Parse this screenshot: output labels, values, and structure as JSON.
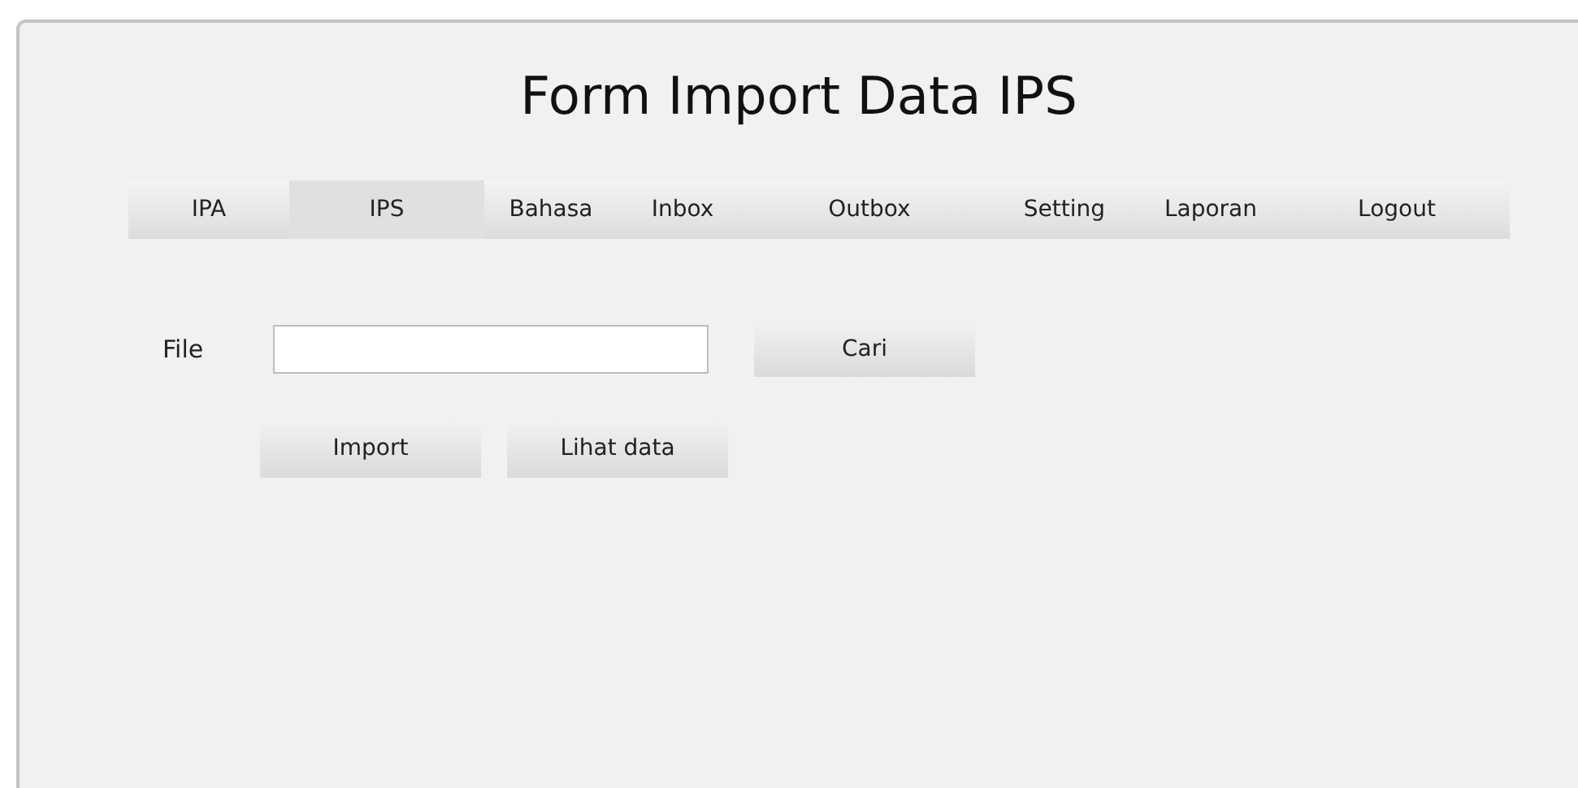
{
  "window": {
    "title": "Form Import Data IPS"
  },
  "tabs": [
    {
      "label": "IPA",
      "selected": false
    },
    {
      "label": "IPS",
      "selected": true
    },
    {
      "label": "Bahasa",
      "selected": false
    },
    {
      "label": "Inbox",
      "selected": false
    },
    {
      "label": "Outbox",
      "selected": false
    },
    {
      "label": "Setting",
      "selected": false
    },
    {
      "label": "Laporan",
      "selected": false
    },
    {
      "label": "Logout",
      "selected": false
    }
  ],
  "file_field": {
    "label": "File"
  },
  "browse_button": "Cari",
  "buttons": [
    "Import",
    "Lihat data"
  ]
}
